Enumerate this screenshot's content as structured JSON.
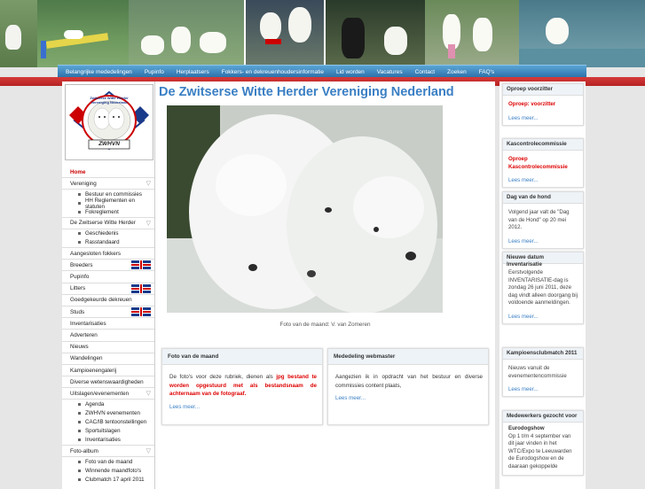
{
  "site": {
    "title": "De Zwitserse Witte Herder Vereniging Nederland",
    "logo_text": "ZWHVN",
    "logo_ring_text": "Zwitserse Witte Herder Vereniging Nederland"
  },
  "nav": {
    "items": [
      "Belangrijke mededelingen",
      "Pupinfo",
      "Herplaatsers",
      "Fokkers- en dekreuenhoudersinformatie",
      "Lid worden",
      "Vacatures",
      "Contact",
      "Zoeken",
      "FAQ's"
    ]
  },
  "menu": {
    "home": "Home",
    "vereniging": "Vereniging",
    "vereniging_sub": [
      "Bestuur en commissies",
      "HH Reglementen en statuten",
      "Fokreglement"
    ],
    "zwh": "De Zwitserse Witte Herder",
    "zwh_sub": [
      "Geschiedenis",
      "Rasstandaard"
    ],
    "items_a": [
      "Aangesloten fokkers"
    ],
    "breeders": "Breeders",
    "pupinfo": "Pupinfo",
    "litters": "Litters",
    "goedgekeurd": "Goedgekeurde dekreuen",
    "studs": "Studs",
    "items_b": [
      "Inventarisaties",
      "Adverteren",
      "Nieuws",
      "Wandelingen",
      "Kampioenengalerij",
      "Diverse wetenswaardigheden"
    ],
    "uitslagen": "Uitslagen/evenementen",
    "uitslagen_sub": [
      "Agenda",
      "ZWHVN evenementen",
      "CAC/IB tentoonstellingen",
      "Sportuitslagen",
      "Inventarisaties"
    ],
    "fotoalbum": "Foto-album",
    "fotoalbum_sub": [
      "Foto van de maand",
      "Winnende maandfoto's",
      "Clubmatch 17 april 2011"
    ]
  },
  "main": {
    "caption": "Foto van de maand: V. van Zomeren",
    "box1": {
      "title": "Foto van de maand",
      "text_a": "De foto's voor deze rubriek, dienen als",
      "text_b": "jpg bestand te worden opgestuurd met als bestandsnaam de achternaam van de fotograaf.",
      "more": "Lees meer..."
    },
    "box2": {
      "title": "Mededeling webmaster",
      "text": "Aangezien ik in opdracht van het bestuur en diverse commissies content plaats,",
      "more": "Lees meer..."
    }
  },
  "right": {
    "b1": {
      "title": "Oproep voorzitter",
      "text": "Oproep: voorzitter",
      "more": "Lees meer..."
    },
    "b2": {
      "title": "Kascontrolecommissie",
      "text": "Oproep Kascontrolecommissie",
      "more": "Lees meer..."
    },
    "b3": {
      "title": "Dag van de hond",
      "text": "Volgend jaar valt de \"Dag van de Hond\" op 20 mei 2012.",
      "more": "Lees meer..."
    },
    "b4": {
      "title": "Nieuwe datum Inventarisatie",
      "text": "Eerstvolgende INVENTARISATIE-dag is zondag 26 juni 2011, deze dag vindt alleen doorgang bij voldoende aanmeldingen.",
      "more": "Lees meer..."
    },
    "b5": {
      "title": "Kampioensclubmatch 2011",
      "text": "Nieuws vanuit de evenementencommissie",
      "more": "Lees meer..."
    },
    "b6": {
      "title": "Medewerkers gezocht voor",
      "subtitle": "Eurodogshow",
      "text": "Op 1 t/m 4 september van dit jaar vinden in het WTC/Expo te Leeuwarden de Eurodogshow en de daaraan gekoppelde"
    }
  },
  "colors": {
    "accent": "#3a7fc4",
    "nav": "#2a6fa8",
    "red": "#c00000"
  }
}
